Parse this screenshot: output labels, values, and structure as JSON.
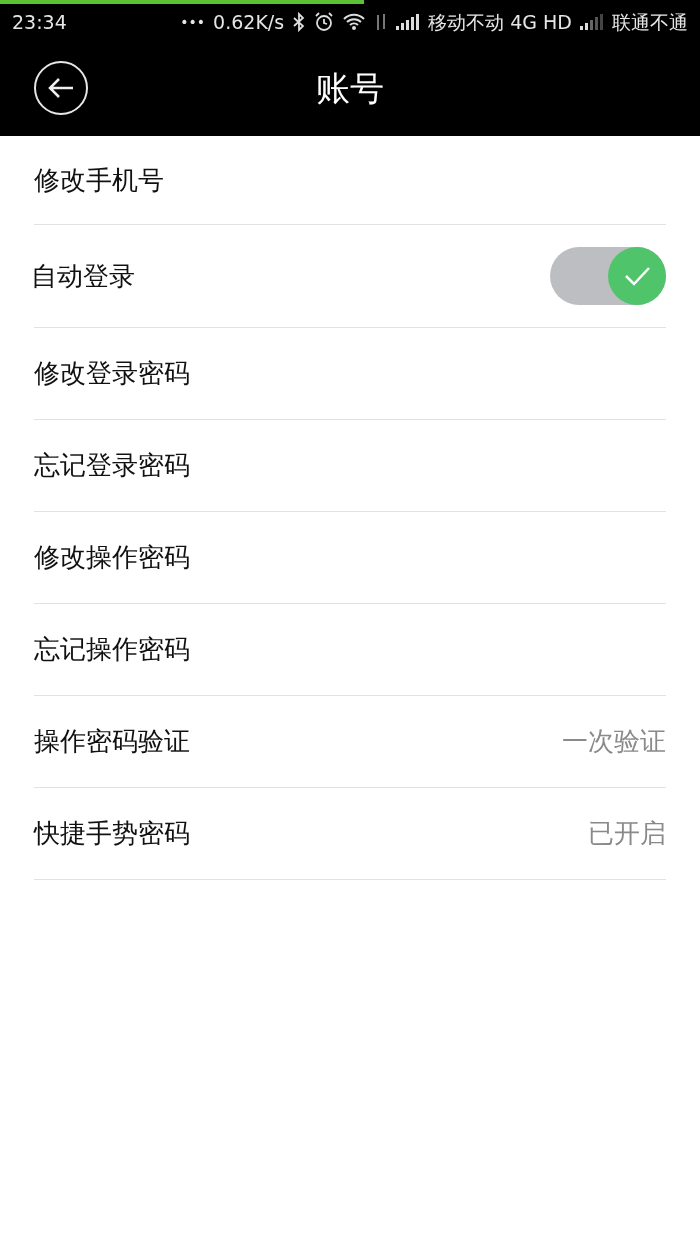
{
  "loading_bar": {
    "level": 0.52
  },
  "status_bar": {
    "time": "23:34",
    "dots": "•••",
    "speed": "0.62K/s",
    "carrier_1": "移动不动 4G HD",
    "carrier_2": "联通不通"
  },
  "header": {
    "title": "账号"
  },
  "items": [
    {
      "kind": "link",
      "label": "修改手机号"
    },
    {
      "kind": "toggle",
      "label": "自动登录",
      "on": true
    },
    {
      "kind": "link",
      "label": "修改登录密码"
    },
    {
      "kind": "link",
      "label": "忘记登录密码"
    },
    {
      "kind": "link",
      "label": "修改操作密码"
    },
    {
      "kind": "link",
      "label": "忘记操作密码"
    },
    {
      "kind": "value",
      "label": "操作密码验证",
      "value": "一次验证"
    },
    {
      "kind": "value",
      "label": "快捷手势密码",
      "value": "已开启"
    }
  ]
}
